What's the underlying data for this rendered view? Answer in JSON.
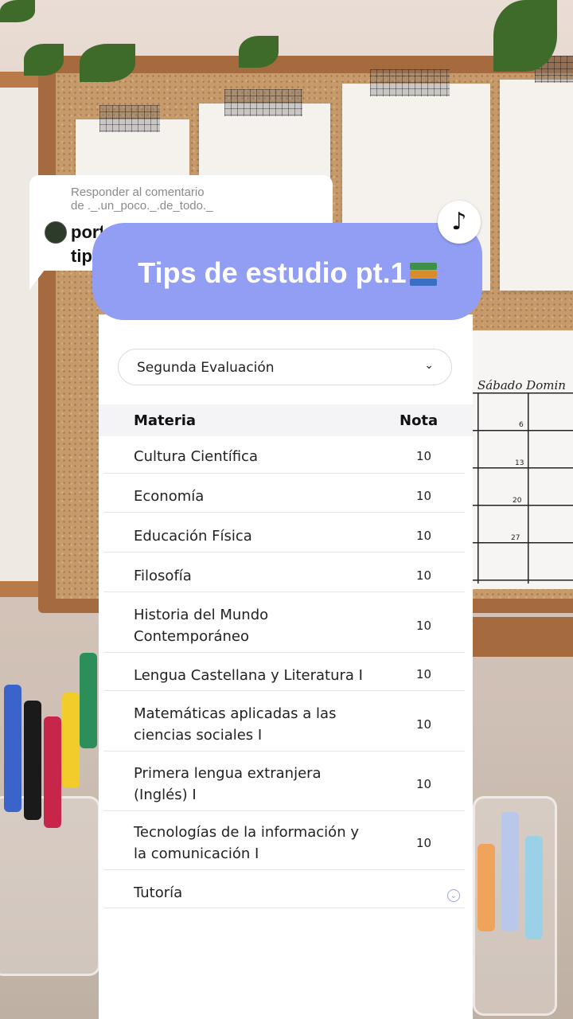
{
  "comment": {
    "reply_label": "Responder al comentario",
    "reply_user": "de ._.un_poco._.de_todo._",
    "text": "porf\ntip"
  },
  "title": {
    "text": "Tips de estudio pt.1",
    "emoji_icon": "books-icon"
  },
  "app_badge": "tiktok-icon",
  "select": {
    "value": "Segunda Evaluación"
  },
  "table": {
    "headers": [
      "Materia",
      "Nota"
    ],
    "rows": [
      {
        "materia": "Cultura Científica",
        "nota": "10"
      },
      {
        "materia": "Economía",
        "nota": "10"
      },
      {
        "materia": "Educación Física",
        "nota": "10"
      },
      {
        "materia": "Filosofía",
        "nota": "10"
      },
      {
        "materia": "Historia del Mundo Contemporáneo",
        "nota": "10"
      },
      {
        "materia": "Lengua Castellana y Literatura I",
        "nota": "10"
      },
      {
        "materia": "Matemáticas aplicadas a las ciencias sociales I",
        "nota": "10"
      },
      {
        "materia": "Primera lengua extranjera (Inglés) I",
        "nota": "10"
      },
      {
        "materia": "Tecnologías de la información y la comunicación I",
        "nota": "10"
      },
      {
        "materia": "Tutoría",
        "nota": ""
      }
    ]
  },
  "calendar": {
    "days": "Sábado  Domin",
    "numbers": [
      "6",
      "13",
      "20",
      "27"
    ]
  },
  "colors": {
    "accent": "#919ef3",
    "panel": "#ffffff",
    "header_bg": "#f4f3f6"
  }
}
